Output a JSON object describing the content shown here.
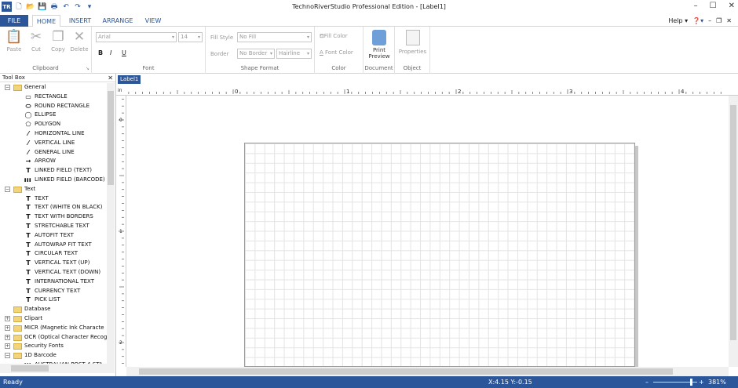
{
  "window": {
    "title": "TechnoRiverStudio Professional Edition - [Label1]",
    "logo": "TR"
  },
  "menu_tabs": [
    "FILE",
    "HOME",
    "INSERT",
    "ARRANGE",
    "VIEW"
  ],
  "help": {
    "label": "Help"
  },
  "ribbon": {
    "clipboard": {
      "group": "Clipboard",
      "paste": "Paste",
      "cut": "Cut",
      "copy": "Copy",
      "delete": "Delete"
    },
    "font": {
      "group": "Font",
      "family": "Arial",
      "size": "14",
      "bold": "B",
      "italic": "I",
      "underline": "U"
    },
    "shape_format": {
      "group": "Shape Format",
      "fill_style_label": "Fill Style",
      "fill_style_value": "No Fill",
      "border_label": "Border",
      "border_value": "No Border",
      "line_value": "Hairline"
    },
    "color": {
      "group": "Color",
      "fill_color": "Fill Color",
      "font_color": "Font Color"
    },
    "document": {
      "group": "Document",
      "print_preview": "Print Preview"
    },
    "object": {
      "group": "Object",
      "properties": "Properties"
    }
  },
  "toolbox": {
    "title": "Tool Box",
    "nodes": [
      {
        "type": "folder",
        "label": "General",
        "exp": "−"
      },
      {
        "type": "item",
        "icon": "▭",
        "label": "RECTANGLE"
      },
      {
        "type": "item",
        "icon": "⬭",
        "label": "ROUND RECTANGLE"
      },
      {
        "type": "item",
        "icon": "◯",
        "label": "ELLIPSE"
      },
      {
        "type": "item",
        "icon": "⬠",
        "label": "POLYGON"
      },
      {
        "type": "item",
        "icon": "⁄",
        "label": "HORIZONTAL LINE"
      },
      {
        "type": "item",
        "icon": "⁄",
        "label": "VERTICAL LINE"
      },
      {
        "type": "item",
        "icon": "⁄",
        "label": "GENERAL LINE"
      },
      {
        "type": "item",
        "icon": "→",
        "label": "ARROW"
      },
      {
        "type": "item",
        "icon": "T",
        "label": "LINKED FIELD (TEXT)"
      },
      {
        "type": "item",
        "icon": "▌▌▌",
        "label": "LINKED FIELD (BARCODE)"
      },
      {
        "type": "folder",
        "label": "Text",
        "exp": "−"
      },
      {
        "type": "item",
        "icon": "T",
        "label": "TEXT"
      },
      {
        "type": "item",
        "icon": "T",
        "label": "TEXT (WHITE ON BLACK)"
      },
      {
        "type": "item",
        "icon": "T",
        "label": "TEXT WITH BORDERS"
      },
      {
        "type": "item",
        "icon": "T",
        "label": "STRETCHABLE TEXT"
      },
      {
        "type": "item",
        "icon": "T",
        "label": "AUTOFIT TEXT"
      },
      {
        "type": "item",
        "icon": "T",
        "label": "AUTOWRAP FIT TEXT"
      },
      {
        "type": "item",
        "icon": "T",
        "label": "CIRCULAR TEXT"
      },
      {
        "type": "item",
        "icon": "T",
        "label": "VERTICAL TEXT (UP)"
      },
      {
        "type": "item",
        "icon": "T",
        "label": "VERTICAL TEXT (DOWN)"
      },
      {
        "type": "item",
        "icon": "T",
        "label": "INTERNATIONAL TEXT"
      },
      {
        "type": "item",
        "icon": "T",
        "label": "CURRENCY TEXT"
      },
      {
        "type": "item",
        "icon": "T",
        "label": "PICK LIST"
      },
      {
        "type": "folder",
        "label": "Database",
        "exp": ""
      },
      {
        "type": "folder",
        "label": "Clipart",
        "exp": "+"
      },
      {
        "type": "folder",
        "label": "MICR (Magnetic Ink Characte",
        "exp": "+"
      },
      {
        "type": "folder",
        "label": "OCR (Optical Character Recog",
        "exp": "+"
      },
      {
        "type": "folder",
        "label": "Security Fonts",
        "exp": "+"
      },
      {
        "type": "folder",
        "label": "1D Barcode",
        "exp": "−"
      },
      {
        "type": "item",
        "icon": "▌▌▌",
        "label": "AUSTRALIAN POST 4-STA"
      }
    ]
  },
  "document": {
    "tab": "Label1",
    "ruler_unit": "in",
    "ruler_labels": [
      "0",
      "1",
      "2",
      "3",
      "4"
    ],
    "vruler_labels": [
      "0",
      "1",
      "2"
    ]
  },
  "status": {
    "text": "Ready",
    "coords": "X:4.15   Y:-0.15",
    "zoom": "381%"
  }
}
